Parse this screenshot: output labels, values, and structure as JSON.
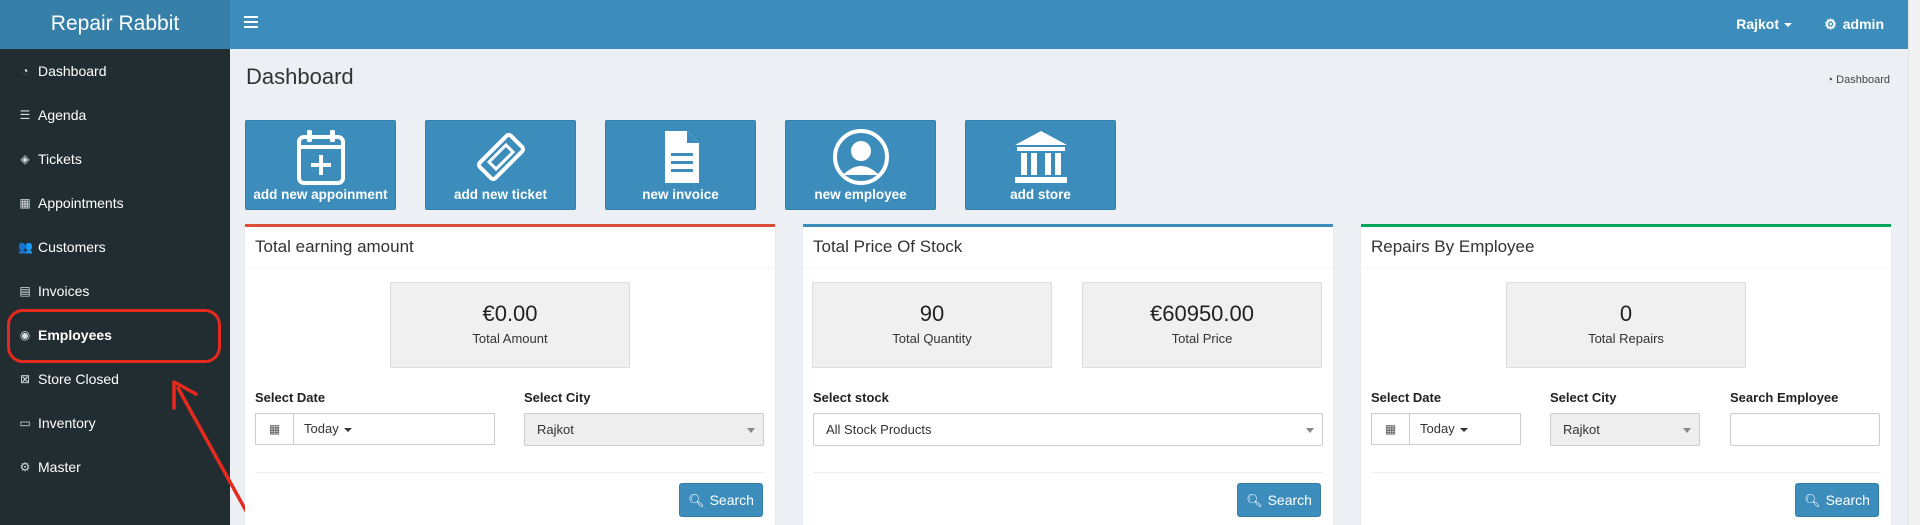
{
  "brand": "Repair Rabbit",
  "topbar": {
    "city": "Rajkot",
    "user": "admin"
  },
  "sidebar": {
    "items": [
      {
        "label": "Dashboard",
        "icon": "dashboard-icon"
      },
      {
        "label": "Agenda",
        "icon": "list-icon"
      },
      {
        "label": "Tickets",
        "icon": "tag-icon"
      },
      {
        "label": "Appointments",
        "icon": "calendar-icon"
      },
      {
        "label": "Customers",
        "icon": "users-icon"
      },
      {
        "label": "Invoices",
        "icon": "file-icon"
      },
      {
        "label": "Employees",
        "icon": "user-circle-icon"
      },
      {
        "label": "Store Closed",
        "icon": "calendar-times-icon"
      },
      {
        "label": "Inventory",
        "icon": "list-alt-icon"
      },
      {
        "label": "Master",
        "icon": "cogs-icon"
      }
    ],
    "highlighted": "Employees"
  },
  "page": {
    "title": "Dashboard",
    "breadcrumb": "Dashboard"
  },
  "quick_actions": [
    {
      "label": "add new appoinment",
      "icon": "calendar-plus-icon"
    },
    {
      "label": "add new ticket",
      "icon": "ticket-icon"
    },
    {
      "label": "new invoice",
      "icon": "document-icon"
    },
    {
      "label": "new employee",
      "icon": "user-circle-icon"
    },
    {
      "label": "add store",
      "icon": "bank-icon"
    }
  ],
  "earning": {
    "title": "Total earning amount",
    "amount": "€0.00",
    "amount_caption": "Total Amount",
    "date_label": "Select Date",
    "date_value": "Today",
    "city_label": "Select City",
    "city_value": "Rajkot",
    "search": "Search",
    "accent": "#dd4b39"
  },
  "stock": {
    "title": "Total Price Of Stock",
    "quantity": "90",
    "quantity_caption": "Total Quantity",
    "price": "€60950.00",
    "price_caption": "Total Price",
    "stock_label": "Select stock",
    "stock_value": "All Stock Products",
    "search": "Search",
    "accent": "#3c8dbc"
  },
  "repairs": {
    "title": "Repairs By Employee",
    "repairs": "0",
    "repairs_caption": "Total Repairs",
    "date_label": "Select Date",
    "date_value": "Today",
    "city_label": "Select City",
    "city_value": "Rajkot",
    "employee_label": "Search Employee",
    "employee_value": "",
    "search": "Search",
    "accent": "#00a65a"
  }
}
